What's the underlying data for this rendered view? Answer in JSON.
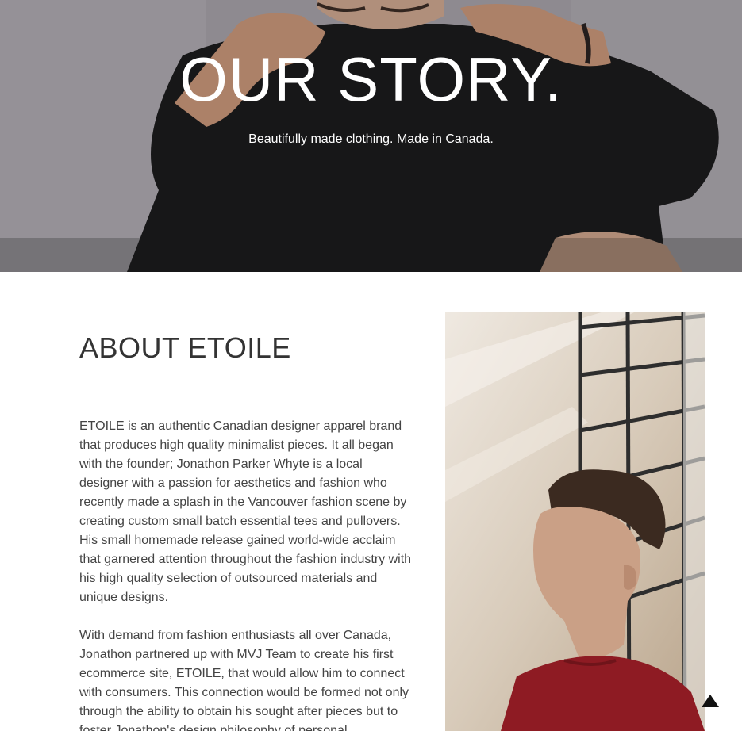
{
  "hero": {
    "title": "OUR STORY.",
    "subtitle": "Beautifully made clothing. Made in Canada."
  },
  "about": {
    "title": "ABOUT ETOILE",
    "paragraphs": [
      "ETOILE is an authentic Canadian designer apparel brand that produces high quality minimalist pieces. It all began with the founder; Jonathon Parker Whyte is a local designer with a passion for aesthetics and fashion who recently made a splash in the Vancouver fashion scene by creating custom small batch essential tees and pullovers. His small homemade release gained world-wide acclaim that garnered attention throughout the fashion industry with his high quality selection of outsourced materials and unique designs.",
      "With demand from fashion enthusiasts all over Canada, Jonathon partnered up with MVJ Team to create his first ecommerce site, ETOILE, that would allow him to connect with consumers. This connection would be formed not only through the ability to obtain his sought after pieces but to foster Jonathon's design philosophy of personal"
    ]
  },
  "icons": {
    "back_to_top": "triangle-up-icon"
  },
  "colors": {
    "heading": "#333333",
    "body_text": "#444444",
    "hero_text": "#ffffff"
  }
}
